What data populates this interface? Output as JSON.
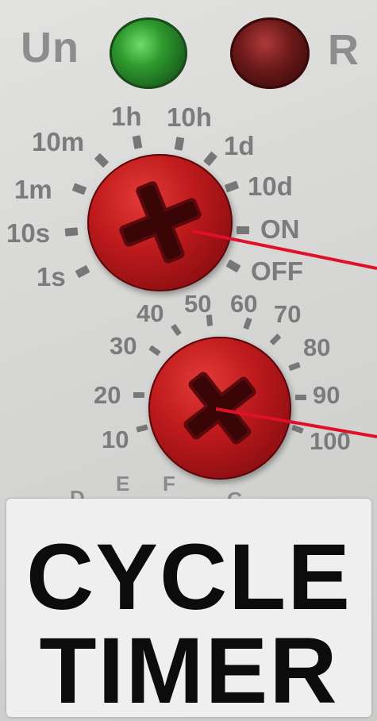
{
  "indicators": {
    "power_label": "Un",
    "relay_label": "R",
    "power_color": "#2e8f2e",
    "relay_color": "#6a1414"
  },
  "range_dial": {
    "labels": [
      "1s",
      "10s",
      "1m",
      "10m",
      "1h",
      "10h",
      "1d",
      "10d",
      "ON",
      "OFF"
    ]
  },
  "percent_dial": {
    "labels": [
      "10",
      "20",
      "30",
      "40",
      "50",
      "60",
      "70",
      "80",
      "90",
      "100"
    ],
    "cut_labels": [
      "D",
      "E",
      "F",
      "G"
    ]
  },
  "product_label": {
    "line1": "CYCLE",
    "line2": "TIMER"
  },
  "colors": {
    "knob": "#c01b1d",
    "wire": "#e0102a",
    "text": "#0c0c0c",
    "scale": "#7b7b7b"
  }
}
